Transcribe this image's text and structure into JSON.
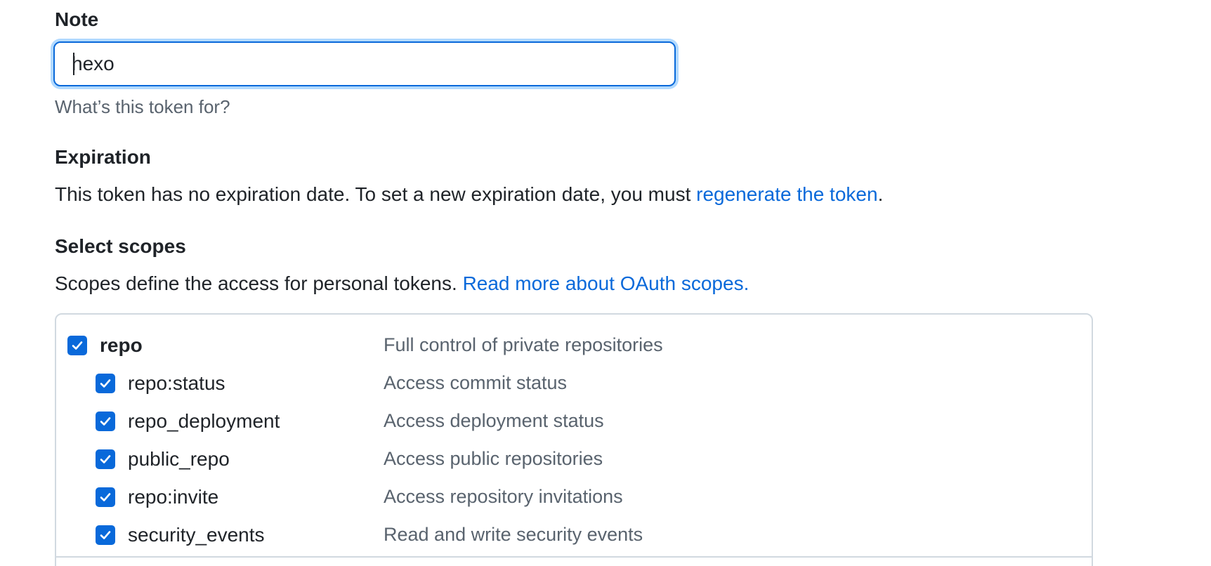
{
  "note": {
    "label": "Note",
    "value": "hexo",
    "hint": "What’s this token for?"
  },
  "expiration": {
    "label": "Expiration",
    "text_before": "This token has no expiration date. To set a new expiration date, you must ",
    "link": "regenerate the token",
    "text_after": "."
  },
  "scopes": {
    "label": "Select scopes",
    "text_before": "Scopes define the access for personal tokens. ",
    "link": "Read more about OAuth scopes.",
    "items": [
      {
        "name": "repo",
        "description": "Full control of private repositories",
        "checked": true
      },
      {
        "name": "repo:status",
        "description": "Access commit status",
        "checked": true
      },
      {
        "name": "repo_deployment",
        "description": "Access deployment status",
        "checked": true
      },
      {
        "name": "public_repo",
        "description": "Access public repositories",
        "checked": true
      },
      {
        "name": "repo:invite",
        "description": "Access repository invitations",
        "checked": true
      },
      {
        "name": "security_events",
        "description": "Read and write security events",
        "checked": true
      }
    ]
  },
  "colors": {
    "accent": "#0969da",
    "muted_text": "#59636e",
    "border": "#d1d9e0"
  }
}
